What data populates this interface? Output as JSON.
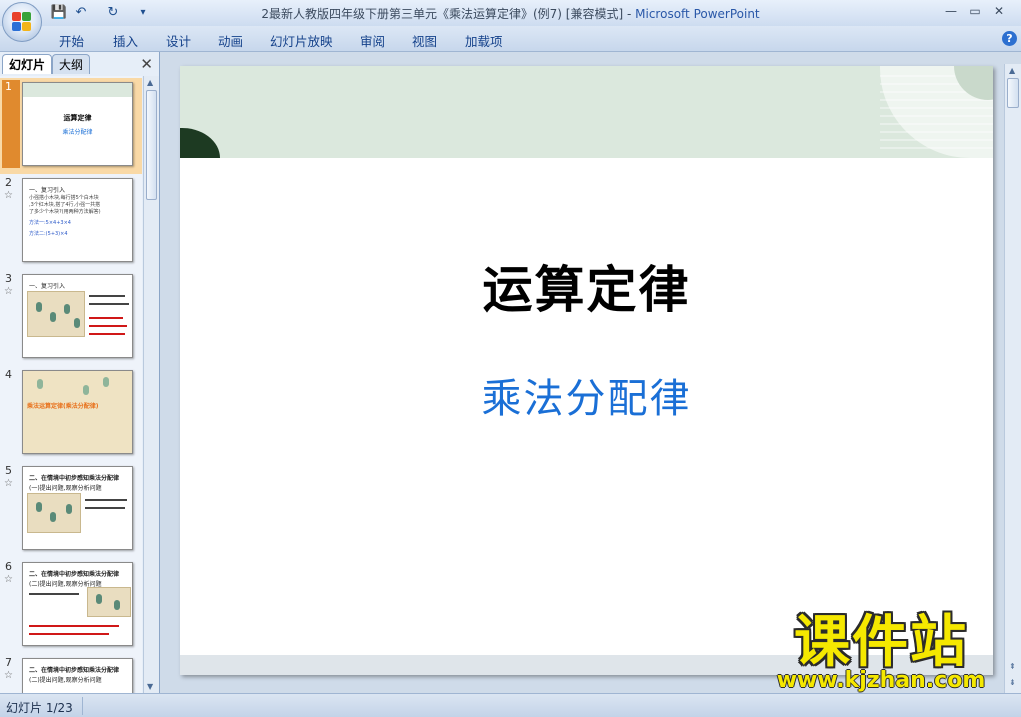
{
  "window": {
    "title_doc": "2最新人教版四年级下册第三单元《乘法运算定律》(例7) [兼容模式]",
    "title_sep": " - ",
    "title_app": "Microsoft PowerPoint",
    "controls": [
      "—",
      "▭",
      "✕"
    ]
  },
  "quick_access": {
    "save": "💾",
    "undo": "↶",
    "redo": "↻",
    "more": "▾"
  },
  "ribbon": {
    "tabs": [
      "开始",
      "插入",
      "设计",
      "动画",
      "幻灯片放映",
      "审阅",
      "视图",
      "加载项"
    ],
    "help": "?"
  },
  "left_panel": {
    "tabs": [
      "幻灯片",
      "大纲"
    ],
    "close": "✕",
    "thumbnails": [
      {
        "num": "1",
        "title": "运算定律",
        "subtitle": "乘法分配律"
      },
      {
        "num": "2",
        "head": "一、复习引入",
        "lines": [
          "小强搭小木块,每行搭5个白木块",
          ",3个红木块,搭了4行,小强一共搭",
          "了多少个木块?(用两种方法解答)"
        ],
        "m1": "方法一:5×4+3×4",
        "m2": "方法二:(5+3)×4"
      },
      {
        "num": "3",
        "head": "一、复习引入"
      },
      {
        "num": "4",
        "banner": "乘法运算定律(乘法分配律)"
      },
      {
        "num": "5",
        "head": "二、在情境中初步感知乘法分配律",
        "sub": "(一)提出问题,观察分析问题"
      },
      {
        "num": "6",
        "head": "二、在情境中初步感知乘法分配律",
        "sub": "(二)提出问题,观察分析问题"
      },
      {
        "num": "7",
        "head": "二、在情境中初步感知乘法分配律",
        "sub": "(二)提出问题,观察分析问题"
      }
    ]
  },
  "slide": {
    "title": "运算定律",
    "subtitle": "乘法分配律"
  },
  "watermark": {
    "text": "课件站",
    "url": "www.kjzhan.com"
  },
  "status": {
    "slide_info": "幻灯片 1/23"
  },
  "colors": {
    "accent": "#1a6fd6",
    "slide_band": "#dbe8dd",
    "dark_green": "#1d3a22",
    "watermark": "#f5e800"
  }
}
